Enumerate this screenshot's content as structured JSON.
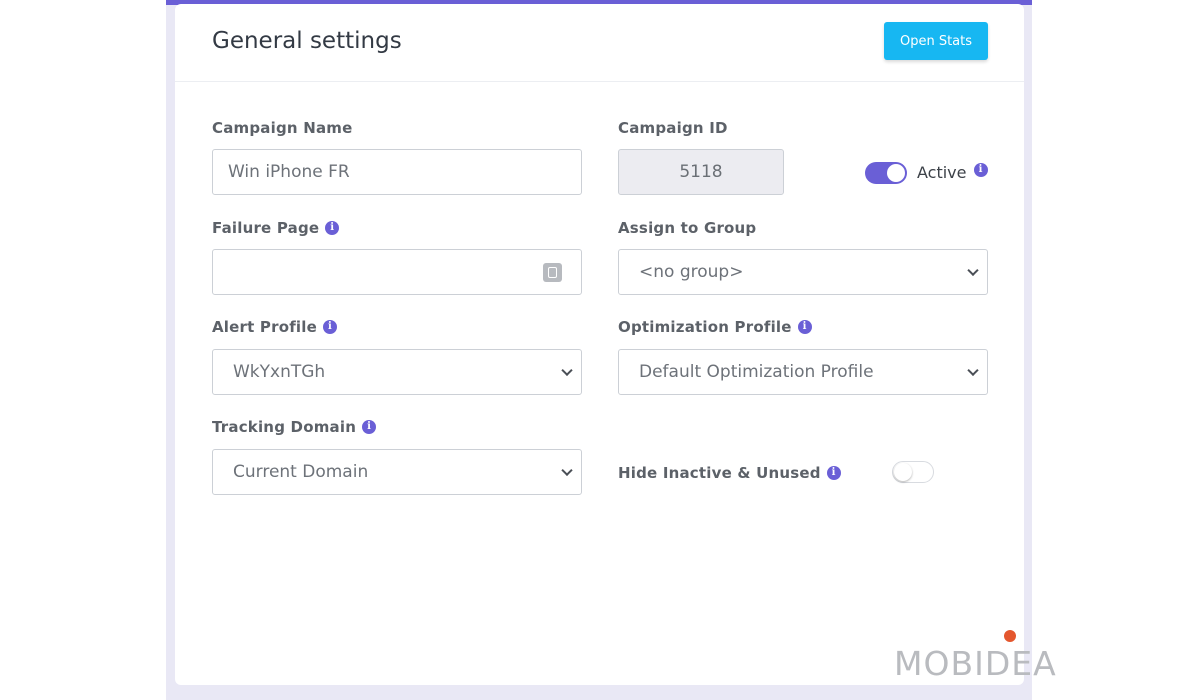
{
  "header": {
    "title": "General settings",
    "open_stats_label": "Open Stats"
  },
  "form": {
    "campaign_name": {
      "label": "Campaign Name",
      "value": "Win iPhone FR"
    },
    "campaign_id": {
      "label": "Campaign ID",
      "value": "5118"
    },
    "active": {
      "label": "Active",
      "on": true
    },
    "failure_page": {
      "label": "Failure Page",
      "value": ""
    },
    "assign_group": {
      "label": "Assign to Group",
      "selected": "<no group>"
    },
    "alert_profile": {
      "label": "Alert Profile",
      "selected": "WkYxnTGh"
    },
    "optimization_profile": {
      "label": "Optimization Profile",
      "selected": "Default Optimization Profile"
    },
    "tracking_domain": {
      "label": "Tracking Domain",
      "selected": "Current Domain"
    },
    "hide_inactive": {
      "label": "Hide Inactive & Unused",
      "on": false
    }
  },
  "icons": {
    "info": "info-icon",
    "chevron": "chevron-down-icon",
    "vault": "vault-icon"
  },
  "colors": {
    "accent": "#6a5fd6",
    "button": "#17b7f2",
    "watermark_dot": "#e4572e"
  },
  "watermark": {
    "text": "MOBIDEA"
  }
}
